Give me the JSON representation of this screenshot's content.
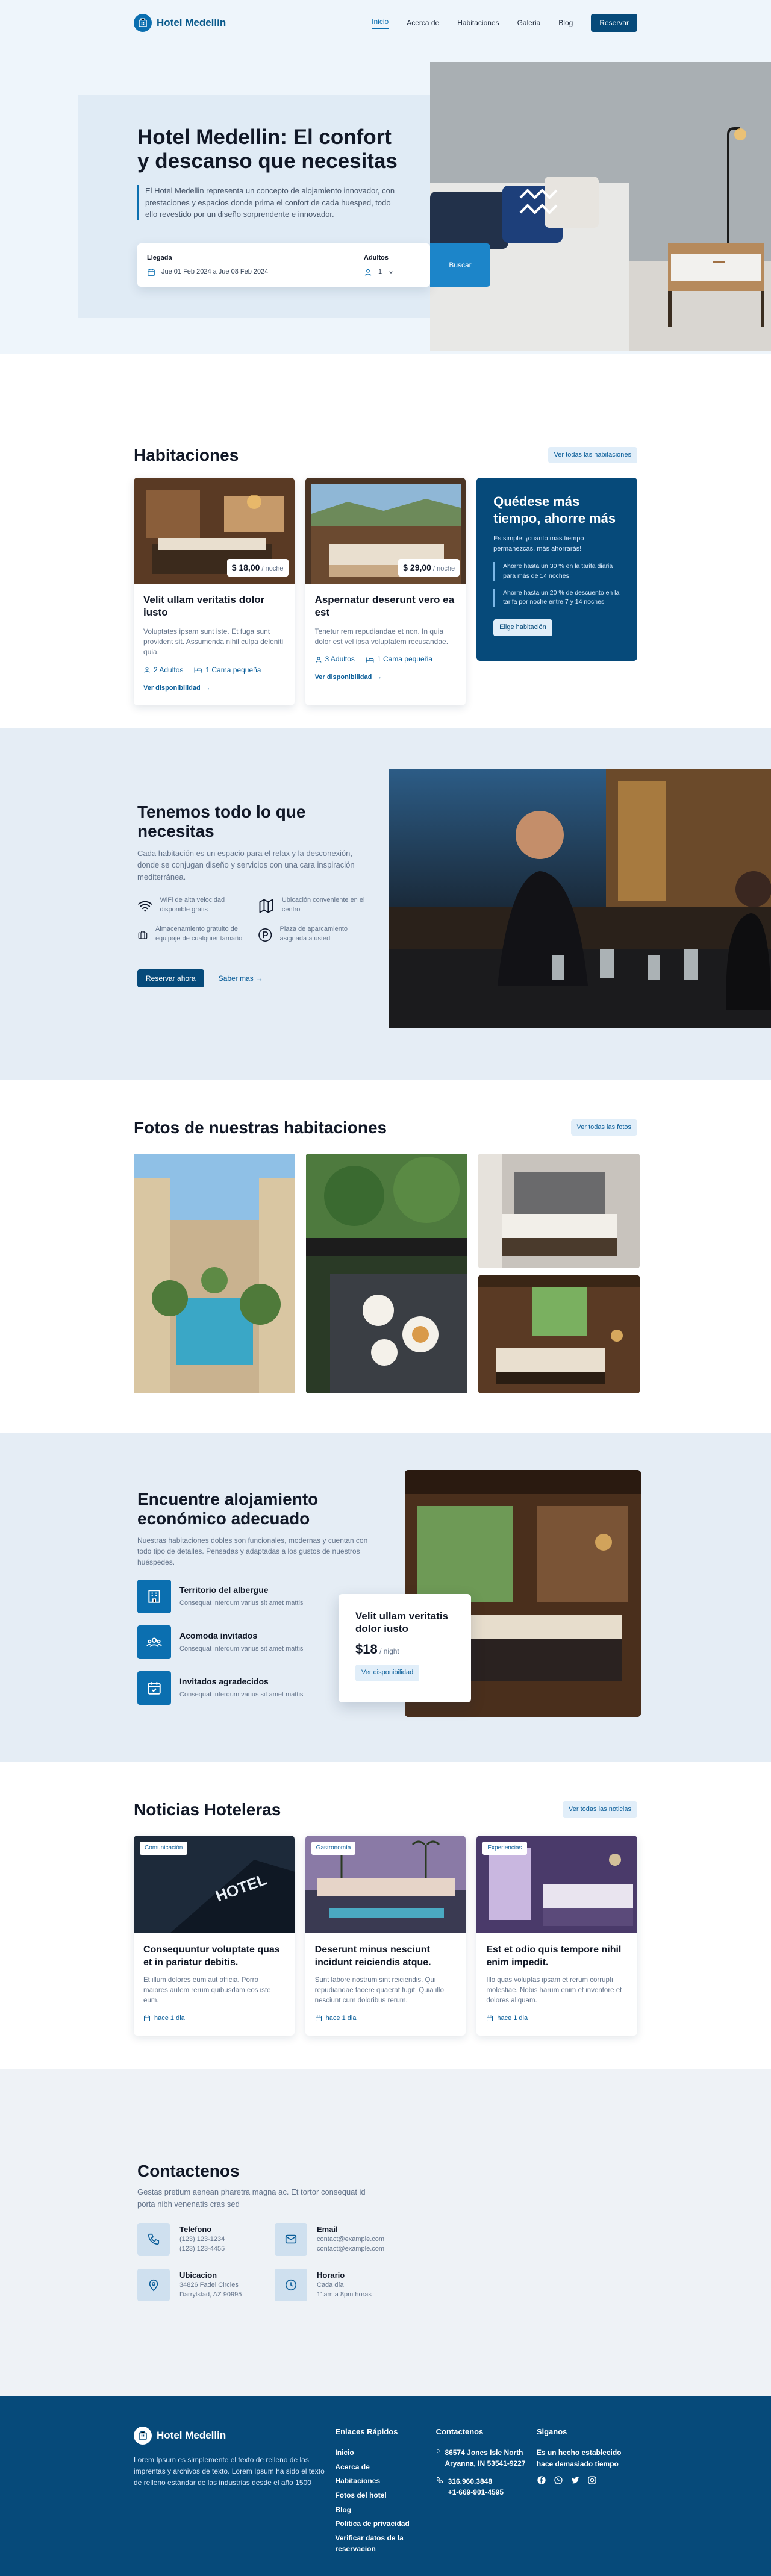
{
  "brand": {
    "name": "Hotel Medellin"
  },
  "nav": {
    "items": [
      {
        "label": "Inicio",
        "active": true
      },
      {
        "label": "Acerca de"
      },
      {
        "label": "Habitaciones"
      },
      {
        "label": "Galeria"
      },
      {
        "label": "Blog"
      }
    ],
    "cta": "Reservar"
  },
  "hero": {
    "title": "Hotel Medellin: El confort y descanso que necesitas",
    "description": "El Hotel Medellin representa un concepto de alojamiento innovador, con prestaciones y espacios donde prima el confort de cada huesped, todo ello revestido por un diseño sorprendente e innovador.",
    "arrival_label": "Llegada",
    "arrival_value": "Jue 01 Feb 2024 a Jue 08 Feb 2024",
    "adults_label": "Adultos",
    "adults_value": "1",
    "search_button": "Buscar"
  },
  "rooms": {
    "title": "Habitaciones",
    "see_all": "Ver todas las habitaciones",
    "items": [
      {
        "price": "$ 18,00",
        "per": "/ noche",
        "title": "Velit ullam veritatis dolor iusto",
        "desc": "Voluptates ipsam sunt iste. Et fuga sunt provident sit. Assumenda nihil culpa deleniti quia.",
        "adults": "2 Adultos",
        "bed": "1 Cama pequeña",
        "link": "Ver disponibilidad"
      },
      {
        "price": "$ 29,00",
        "per": "/ noche",
        "title": "Aspernatur deserunt vero ea est",
        "desc": "Tenetur rem repudiandae et non. In quia dolor est vel ipsa voluptatem recusandae.",
        "adults": "3 Adultos",
        "bed": "1 Cama pequeña",
        "link": "Ver disponibilidad"
      }
    ],
    "promo": {
      "title": "Quédese más tiempo, ahorre más",
      "desc": "Es simple: ¡cuanto más tiempo permanezcas, más ahorrarás!",
      "points": [
        "Ahorre hasta un 30 % en la tarifa diaria para más de 14 noches",
        "Ahorre hasta un 20 % de descuento en la tarifa por noche entre 7 y 14 noches"
      ],
      "button": "Elige habitación"
    }
  },
  "amenities": {
    "title": "Tenemos todo lo que necesitas",
    "desc": "Cada habitación es un espacio para el relax y la desconexión, donde se conjugan diseño y servicios con una cara inspiración mediterránea.",
    "items": [
      {
        "icon": "wifi-icon",
        "text": "WiFi de alta velocidad disponible gratis"
      },
      {
        "icon": "map-icon",
        "text": "Ubicación conveniente en el centro"
      },
      {
        "icon": "luggage-icon",
        "text": "Almacenamiento gratuito de equipaje de cualquier tamaño"
      },
      {
        "icon": "parking-icon",
        "text": "Plaza de aparcamiento asignada a usted"
      }
    ],
    "book_button": "Reservar ahora",
    "more_link": "Saber mas"
  },
  "photos": {
    "title": "Fotos de nuestras habitaciones",
    "see_all": "Ver todas las fotos"
  },
  "budget": {
    "title": "Encuentre alojamiento económico adecuado",
    "desc": "Nuestras habitaciones dobles son funcionales, modernas y cuentan con todo tipo de detalles. Pensadas y adaptadas a los gustos de nuestros huéspedes.",
    "features": [
      {
        "icon": "building-icon",
        "title": "Territorio del albergue",
        "text": "Consequat interdum varius sit amet mattis"
      },
      {
        "icon": "users-icon",
        "title": "Acomoda invitados",
        "text": "Consequat interdum varius sit amet mattis"
      },
      {
        "icon": "calendar-check-icon",
        "title": "Invitados agradecidos",
        "text": "Consequat interdum varius sit amet mattis"
      }
    ],
    "card": {
      "title": "Velit ullam veritatis dolor iusto",
      "price": "$18",
      "per": "/ night",
      "button": "Ver disponibilidad"
    }
  },
  "news": {
    "title": "Noticias Hoteleras",
    "see_all": "Ver todas las noticias",
    "items": [
      {
        "tag": "Comunicación",
        "title": "Consequuntur voluptate quas et in pariatur debitis.",
        "desc": "Et illum dolores eum aut officia. Porro maiores autem rerum quibusdam eos iste eum.",
        "date": "hace 1 dia"
      },
      {
        "tag": "Gastronomía",
        "title": "Deserunt minus nesciunt incidunt reiciendis atque.",
        "desc": "Sunt labore nostrum sint reiciendis. Qui repudiandae facere quaerat fugit. Quia illo nesciunt cum doloribus rerum.",
        "date": "hace 1 dia"
      },
      {
        "tag": "Experiencias",
        "title": "Est et odio quis tempore nihil enim impedit.",
        "desc": "Illo quas voluptas ipsam et rerum corrupti molestiae. Nobis harum enim et inventore et dolores aliquam.",
        "date": "hace 1 dia"
      }
    ]
  },
  "contact": {
    "title": "Contactenos",
    "desc": "Gestas pretium aenean pharetra magna ac. Et tortor consequat id porta nibh venenatis cras sed",
    "items": [
      {
        "icon": "phone-icon",
        "title": "Telefono",
        "lines": [
          "(123) 123-1234",
          "(123) 123-4455"
        ]
      },
      {
        "icon": "mail-icon",
        "title": "Email",
        "lines": [
          "contact@example.com",
          "contact@example.com"
        ]
      },
      {
        "icon": "location-icon",
        "title": "Ubicacion",
        "lines": [
          "34826 Fadel Circles",
          "Darrylstad, AZ 90995"
        ]
      },
      {
        "icon": "clock-icon",
        "title": "Horario",
        "lines": [
          "Cada día",
          "11am a 8pm horas"
        ]
      }
    ]
  },
  "footer": {
    "desc": "Lorem Ipsum es simplemente el texto de relleno de las imprentas y archivos de texto. Lorem Ipsum ha sido el texto de relleno estándar de las industrias desde el año 1500",
    "links_title": "Enlaces Rápidos",
    "links": [
      "Inicio",
      "Acerca de",
      "Habitaciones",
      "Fotos del hotel",
      "Blog",
      "Politica de privacidad",
      "Verificar datos de la reservacion"
    ],
    "contacts_title": "Contactenos",
    "address": "86574 Jones Isle North Aryanna, IN 53541-9227",
    "phone1": "316.960.3848",
    "phone2": "+1-669-901-4595",
    "social_title": "Siganos",
    "social_desc": "Es un hecho establecido hace demasiado tiempo"
  }
}
